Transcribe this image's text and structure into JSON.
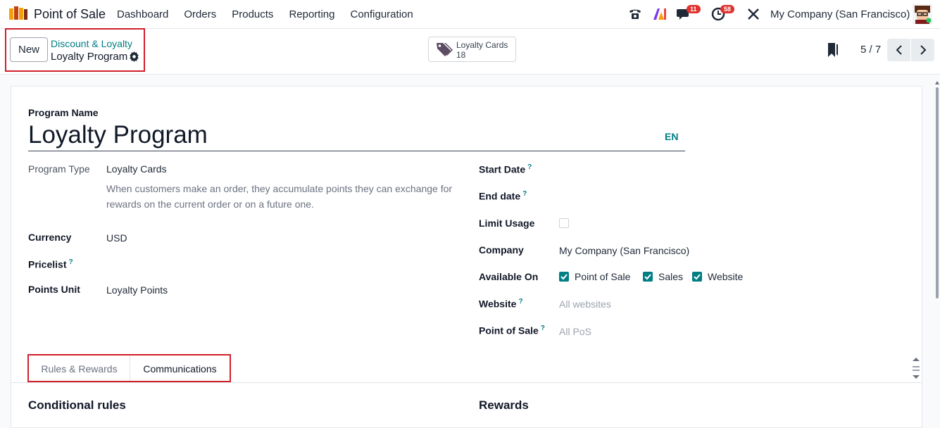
{
  "navbar": {
    "app_name": "Point of Sale",
    "menu": [
      "Dashboard",
      "Orders",
      "Products",
      "Reporting",
      "Configuration"
    ],
    "badges": {
      "chat": "11",
      "activity": "58"
    },
    "company": "My Company (San Francisco)"
  },
  "control_panel": {
    "new_label": "New",
    "breadcrumb_parent": "Discount & Loyalty",
    "breadcrumb_current": "Loyalty Program",
    "smart_button": {
      "label": "Loyalty Cards",
      "value": "18"
    },
    "pager": "5 / 7"
  },
  "form": {
    "program_name_label": "Program Name",
    "program_name": "Loyalty Program",
    "lang": "EN",
    "program_type_label": "Program Type",
    "program_type": "Loyalty Cards",
    "program_type_desc": "When customers make an order, they accumulate points they can exchange for rewards on the current order or on a future one.",
    "currency_label": "Currency",
    "currency": "USD",
    "pricelist_label": "Pricelist",
    "points_unit_label": "Points Unit",
    "points_unit": "Loyalty Points",
    "start_date_label": "Start Date",
    "end_date_label": "End date",
    "limit_usage_label": "Limit Usage",
    "company_label": "Company",
    "company": "My Company (San Francisco)",
    "available_on_label": "Available On",
    "available_on": [
      "Point of Sale",
      "Sales",
      "Website"
    ],
    "website_label": "Website",
    "website_placeholder": "All websites",
    "pos_label": "Point of Sale",
    "pos_placeholder": "All PoS"
  },
  "tabs": [
    "Rules & Rewards",
    "Communications"
  ],
  "sections": {
    "left": "Conditional rules",
    "right": "Rewards"
  },
  "colors": {
    "accent": "#017e84",
    "highlight": "#d11f2b",
    "badge": "#e0322f"
  }
}
